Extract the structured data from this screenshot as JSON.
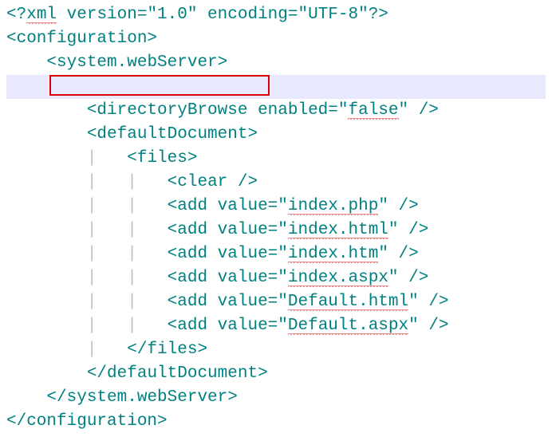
{
  "lines": {
    "l1_open": "<?",
    "l1_xml": "xml",
    "l1_rest": " version=\"1.0\" encoding=\"UTF-8\"?>",
    "l2": "<configuration>",
    "l3_pad": "    ",
    "l3_tag": "<system.webServer>",
    "l5_pad": "        ",
    "l5_a": "<directoryBrowse enabled=\"",
    "l5_false": "false",
    "l5_b": "\" />",
    "l6_pad": "        ",
    "l6_tag": "<defaultDocument>",
    "l7_pad": "        ",
    "l7_guide": "|   ",
    "l7_tag": "<files>",
    "l8_pad": "        ",
    "l8_guide": "|   |   ",
    "l8_tag": "<clear />",
    "l9_pad": "        ",
    "l9_guide": "|   |   ",
    "l9_a": "<add value=\"",
    "l9_v": "index.php",
    "l9_b": "\" />",
    "l10_pad": "        ",
    "l10_guide": "|   |   ",
    "l10_a": "<add value=\"",
    "l10_v": "index.html",
    "l10_b": "\" />",
    "l11_pad": "        ",
    "l11_guide": "|   |   ",
    "l11_a": "<add value=\"",
    "l11_v": "index.htm",
    "l11_b": "\" />",
    "l12_pad": "        ",
    "l12_guide": "|   |   ",
    "l12_a": "<add value=\"",
    "l12_v": "index.aspx",
    "l12_b": "\" />",
    "l13_pad": "        ",
    "l13_guide": "|   |   ",
    "l13_a": "<add value=\"",
    "l13_v": "Default.html",
    "l13_b": "\" />",
    "l14_pad": "        ",
    "l14_guide": "|   |   ",
    "l14_a": "<add value=\"",
    "l14_v": "Default.aspx",
    "l14_b": "\" />",
    "l15_pad": "        ",
    "l15_guide": "|   ",
    "l15_tag": "</files>",
    "l16_pad": "        ",
    "l16_tag": "</defaultDocument>",
    "l17_pad": "    ",
    "l17_tag": "</system.webServer>",
    "l18": "</configuration>"
  }
}
